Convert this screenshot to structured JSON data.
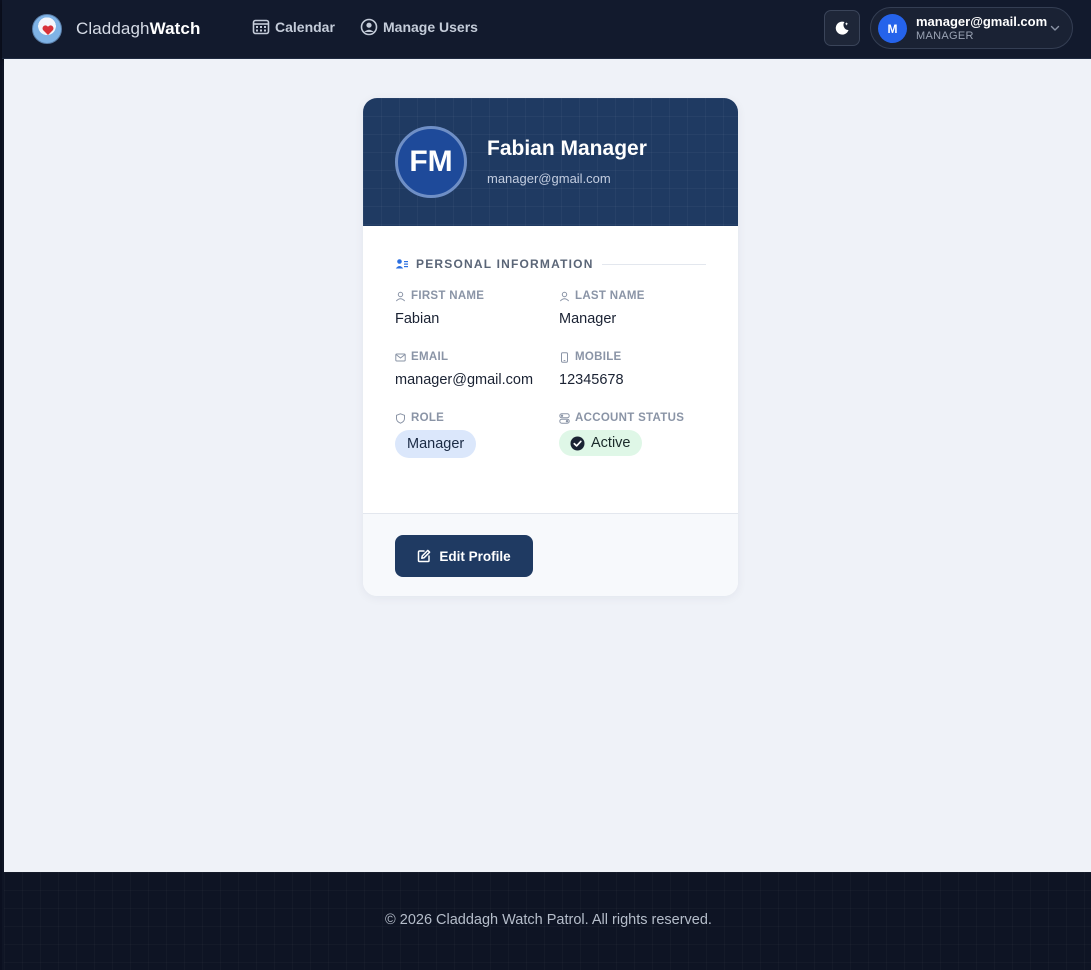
{
  "brand": {
    "name_light": "Claddagh",
    "name_bold": "Watch"
  },
  "nav": {
    "calendar_label": "Calendar",
    "manage_users_label": "Manage Users"
  },
  "user_menu": {
    "avatar_initial": "M",
    "email": "manager@gmail.com",
    "role": "MANAGER"
  },
  "profile": {
    "initials": "FM",
    "full_name": "Fabian Manager",
    "email": "manager@gmail.com",
    "section_title": "PERSONAL INFORMATION",
    "fields": {
      "first_name": {
        "label": "FIRST NAME",
        "value": "Fabian"
      },
      "last_name": {
        "label": "LAST NAME",
        "value": "Manager"
      },
      "email": {
        "label": "EMAIL",
        "value": "manager@gmail.com"
      },
      "mobile": {
        "label": "MOBILE",
        "value": "12345678"
      },
      "role": {
        "label": "ROLE",
        "value": "Manager"
      },
      "status": {
        "label": "ACCOUNT STATUS",
        "value": "Active"
      }
    },
    "edit_button_label": "Edit Profile"
  },
  "footer": {
    "text": "© 2026 Claddagh Watch Patrol. All rights reserved."
  },
  "colors": {
    "navbar_bg": "#121a2d",
    "accent_navy": "#1f3a62",
    "avatar_blue": "#2563eb",
    "active_green_bg": "#dff7e7",
    "role_blue_bg": "#dbe7fb",
    "page_bg": "#eff2f8"
  },
  "icons": {
    "calendar": "calendar-icon",
    "users": "user-circle-icon",
    "theme": "moon-icon",
    "chevron": "chevron-down-icon",
    "section": "users-list-icon",
    "edit": "edit-icon",
    "status": "check-circle-icon"
  }
}
